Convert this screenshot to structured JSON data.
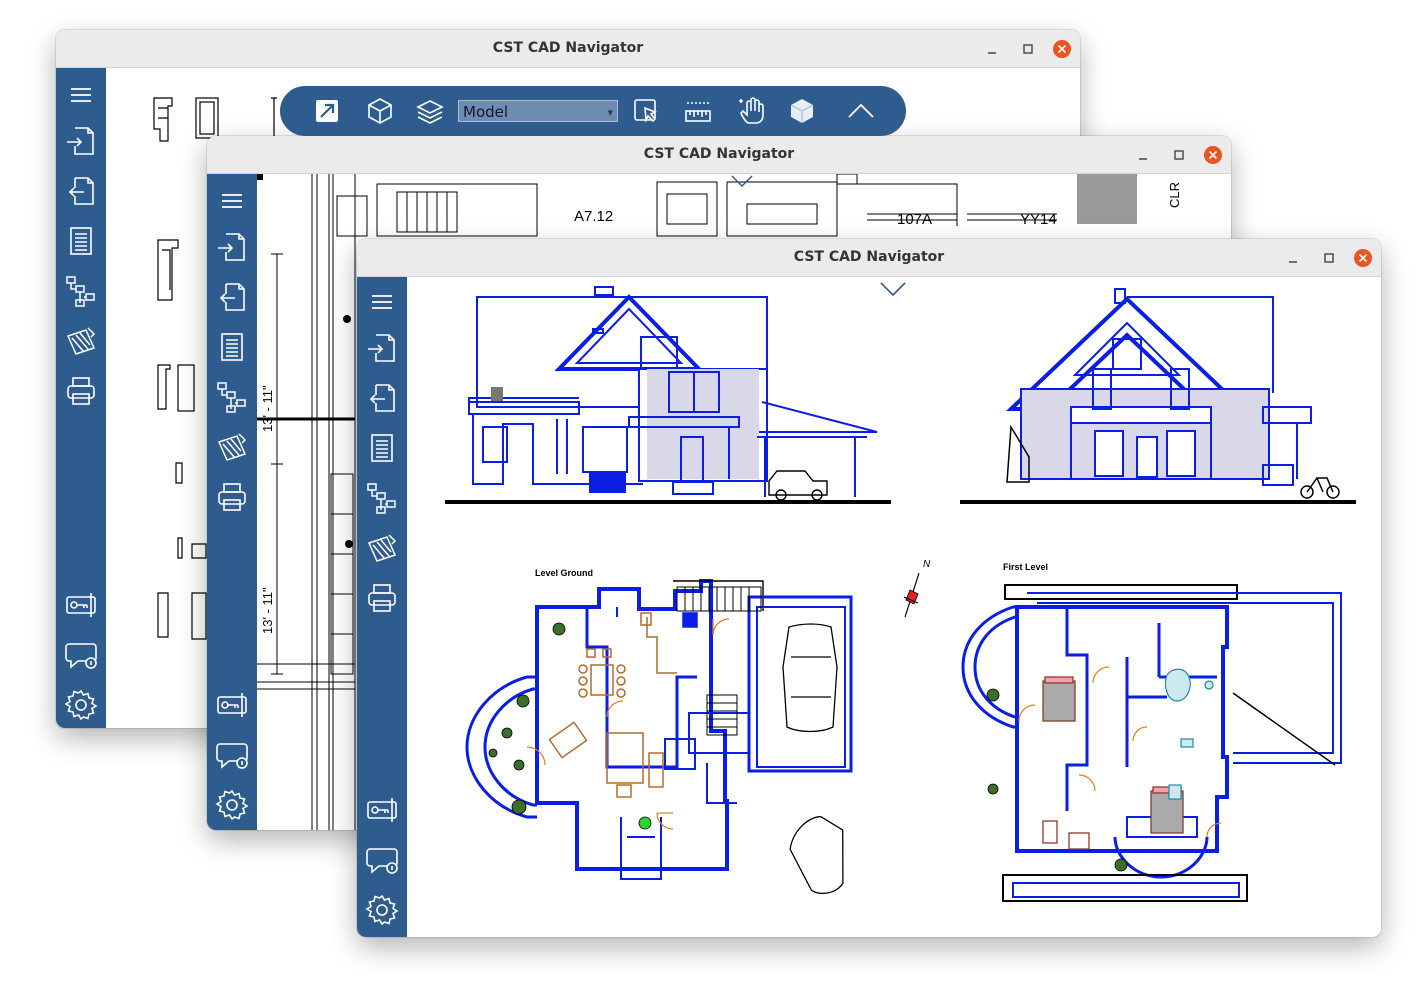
{
  "windows": [
    {
      "title": "CST CAD Navigator"
    },
    {
      "title": "CST CAD Navigator"
    },
    {
      "title": "CST CAD Navigator"
    }
  ],
  "toolbar": {
    "view_mode": "Model"
  },
  "sidebar": {
    "items": [
      "menu-icon",
      "open-file-icon",
      "import-icon",
      "document-icon",
      "layers-tree-icon",
      "markup-icon",
      "print-icon",
      "license-key-icon",
      "feedback-icon",
      "settings-icon"
    ]
  },
  "drawing": {
    "level_ground_label": "Level Ground",
    "first_level_label": "First Level",
    "north_label": "N",
    "dimension_1": "13' - 11\"",
    "dimension_2": "13' - 11\"",
    "tag_a712": "A7.12",
    "tag_107a": "107A",
    "tag_yy14a": "YY14",
    "tag_yy14b": "YY14",
    "tag_clr": "CLR"
  },
  "colors": {
    "sidebar": "#2f5c8f",
    "titlebar": "#ebebeb",
    "close_button": "#e95420",
    "drawing_blue": "#0a1ee6",
    "furniture": "#b36a2a"
  }
}
